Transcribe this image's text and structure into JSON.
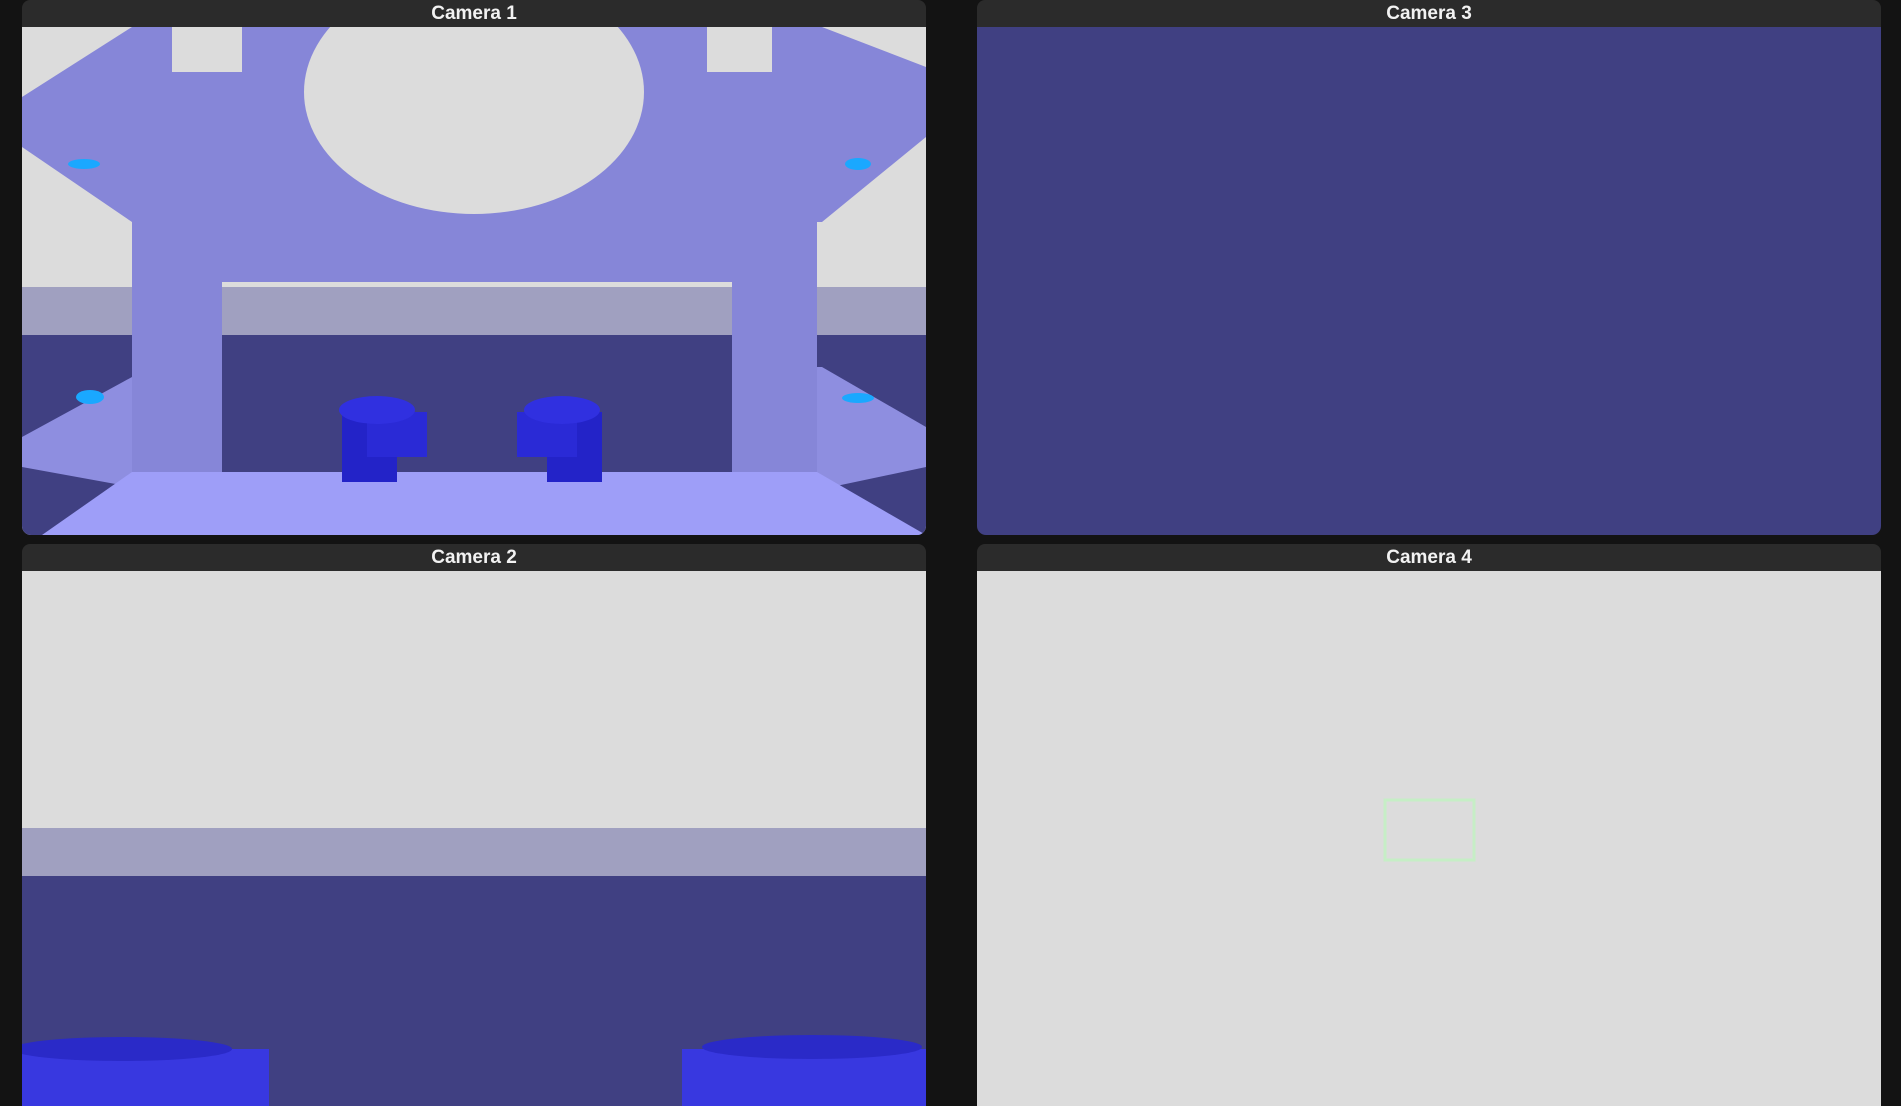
{
  "cameras": [
    {
      "id": "camera-1",
      "title": "Camera 1",
      "scene": "gripper-view"
    },
    {
      "id": "camera-2",
      "title": "Camera 2",
      "scene": "low-table-view"
    },
    {
      "id": "camera-3",
      "title": "Camera 3",
      "scene": "solid-floor-view"
    },
    {
      "id": "camera-4",
      "title": "Camera 4",
      "scene": "wall-view"
    }
  ],
  "colors": {
    "background": "#131313",
    "header": "#2b2b2b",
    "header_text": "#f2f2f2",
    "wall": "#dcdcdc",
    "floor": "#404082",
    "table_edge": "#a0a0c0",
    "gripper": "#8686d8",
    "gripper_light": "#9e9ef8",
    "block": "#2323c8",
    "sensor": "#1aa8ff",
    "target_outline": "#c6eec6"
  }
}
